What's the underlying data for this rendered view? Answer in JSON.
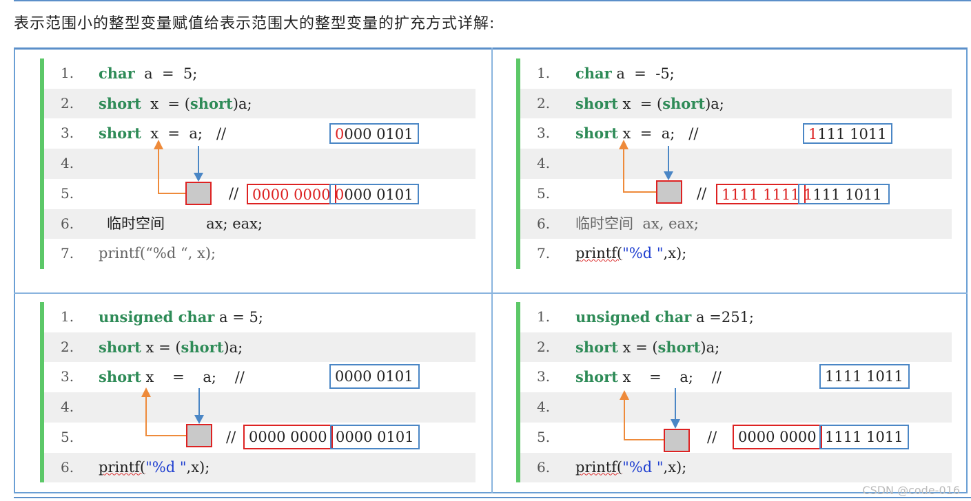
{
  "heading": "表示范围小的整型变量赋值给表示范围大的整型变量的扩充方式详解:",
  "watermark": "CSDN @code-016",
  "colors": {
    "keyword": "#2e8b57",
    "highlight": "#d22",
    "frame": "#4a86c5",
    "string": "#1f3fd0",
    "bar": "#5cc868"
  },
  "panels": [
    {
      "lines": [
        {
          "n": "1.",
          "kw": "char",
          "rest": "  a  =  5;"
        },
        {
          "n": "2.",
          "kw": "short",
          "rest": "  x  = (",
          "kw2": "short",
          "rest2": ")a;"
        },
        {
          "n": "3.",
          "kw": "short",
          "rest": "  x  =  a;   //"
        },
        {
          "n": "4."
        },
        {
          "n": "5.",
          "rest": "//"
        },
        {
          "n": "6.",
          "rest": "临时空间         ax; eax;"
        },
        {
          "n": "7.",
          "rest": "printf(“%d “, x);"
        }
      ],
      "box_low": {
        "hi": "0",
        "lo": "000 0101"
      },
      "box_high": "0000 0000",
      "box_low5": {
        "hi": "0",
        "lo": "000 0101"
      }
    },
    {
      "lines": [
        {
          "n": "1.",
          "kw": "char",
          "rest": " a  =  -5;"
        },
        {
          "n": "2.",
          "kw": "short",
          "rest": " x  = (",
          "kw2": "short",
          "rest2": ")a;"
        },
        {
          "n": "3.",
          "kw": "short",
          "rest": " x  =  a;   //"
        },
        {
          "n": "4."
        },
        {
          "n": "5.",
          "rest": "//"
        },
        {
          "n": "6.",
          "rest": "临时空间  ax, eax;"
        },
        {
          "n": "7.",
          "rest": "printf(",
          "str": "\"%d \"",
          "rest2": ",x);"
        }
      ],
      "box_low": {
        "hi": "1",
        "lo": "111 1011"
      },
      "box_high": "1111 1111",
      "box_low5": {
        "hi": "1",
        "lo": "111 1011"
      }
    },
    {
      "lines": [
        {
          "n": "1.",
          "kw": "unsigned char",
          "rest": " a = 5;"
        },
        {
          "n": "2.",
          "kw": "short",
          "rest": " x = (",
          "kw2": "short",
          "rest2": ")a;"
        },
        {
          "n": "3.",
          "kw": "short",
          "rest": " x    =    a;    //"
        },
        {
          "n": "4."
        },
        {
          "n": "5.",
          "rest": "//"
        },
        {
          "n": "6.",
          "rest": "printf(",
          "str": "\"%d \"",
          "rest2": ",x);"
        }
      ],
      "box_low": "0000 0101",
      "box_high": "0000 0000",
      "box_low5": "0000 0101"
    },
    {
      "lines": [
        {
          "n": "1.",
          "kw": "unsigned char",
          "rest": " a =251;"
        },
        {
          "n": "2.",
          "kw": "short",
          "rest": " x = (",
          "kw2": "short",
          "rest2": ")a;"
        },
        {
          "n": "3.",
          "kw": "short",
          "rest": " x    =    a;    //"
        },
        {
          "n": "4."
        },
        {
          "n": "5.",
          "rest": "//"
        },
        {
          "n": "6.",
          "rest": "printf(",
          "str": "\"%d \"",
          "rest2": ",x);"
        }
      ],
      "box_low": "1111 1011",
      "box_high": "0000 0000",
      "box_low5": "1111 1011"
    }
  ]
}
